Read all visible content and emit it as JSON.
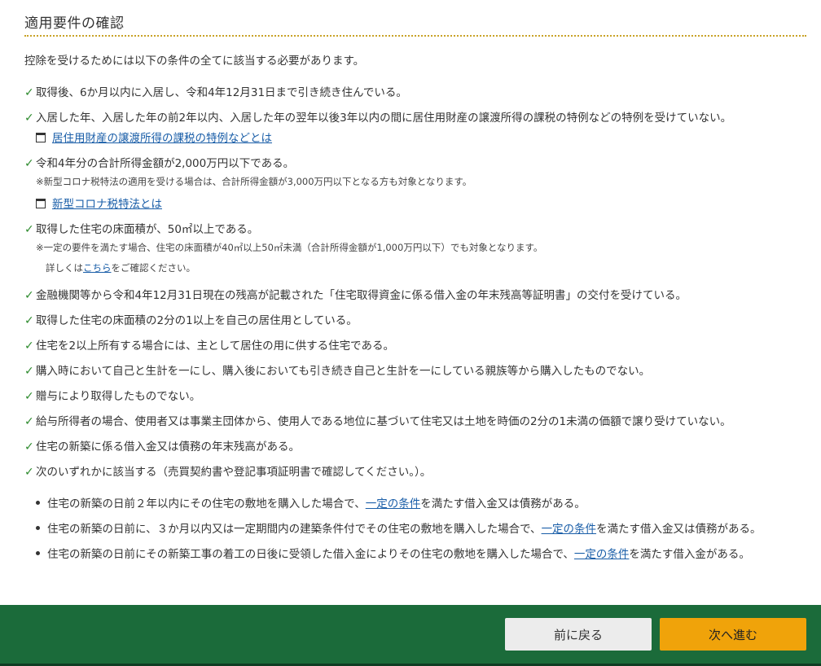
{
  "page": {
    "title": "適用要件の確認",
    "intro": "控除を受けるためには以下の条件の全てに該当する必要があります。"
  },
  "requirements": [
    {
      "text": "取得後、6か月以内に入居し、令和4年12月31日まで引き続き住んでいる。"
    },
    {
      "text": "入居した年、入居した年の前2年以内、入居した年の翌年以後3年以内の間に居住用財産の譲渡所得の課税の特例などの特例を受けていない。",
      "link": "居住用財産の譲渡所得の課税の特例などとは"
    },
    {
      "text": "令和4年分の合計所得金額が2,000万円以下である。",
      "note": "※新型コロナ税特法の適用を受ける場合は、合計所得金額が3,000万円以下となる方も対象となります。",
      "link": "新型コロナ税特法とは"
    },
    {
      "text": "取得した住宅の床面積が、50㎡以上である。",
      "note": "※一定の要件を満たす場合、住宅の床面積が40㎡以上50㎡未満（合計所得金額が1,000万円以下）でも対象となります。",
      "note2_prefix": "詳しくは",
      "note2_link": "こちら",
      "note2_suffix": "をご確認ください。"
    },
    {
      "text": "金融機関等から令和4年12月31日現在の残高が記載された「住宅取得資金に係る借入金の年末残高等証明書」の交付を受けている。"
    },
    {
      "text": "取得した住宅の床面積の2分の1以上を自己の居住用としている。"
    },
    {
      "text": "住宅を2以上所有する場合には、主として居住の用に供する住宅である。"
    },
    {
      "text": "購入時において自己と生計を一にし、購入後においても引き続き自己と生計を一にしている親族等から購入したものでない。"
    },
    {
      "text": "贈与により取得したものでない。"
    },
    {
      "text": "給与所得者の場合、使用者又は事業主団体から、使用人である地位に基づいて住宅又は土地を時価の2分の1未満の価額で譲り受けていない。"
    },
    {
      "text": "住宅の新築に係る借入金又は債務の年末残高がある。"
    },
    {
      "text": "次のいずれかに該当する（売買契約書や登記事項証明書で確認してください。）。"
    }
  ],
  "sub_items": [
    {
      "prefix": "住宅の新築の日前２年以内にその住宅の敷地を購入した場合で、",
      "link": "一定の条件",
      "suffix": "を満たす借入金又は債務がある。"
    },
    {
      "prefix": "住宅の新築の日前に、３か月以内又は一定期間内の建築条件付でその住宅の敷地を購入した場合で、",
      "link": "一定の条件",
      "suffix": "を満たす借入金又は債務がある。"
    },
    {
      "prefix": "住宅の新築の日前にその新築工事の着工の日後に受領した借入金によりその住宅の敷地を購入した場合で、",
      "link": "一定の条件",
      "suffix": "を満たす借入金がある。"
    }
  ],
  "icons": {
    "check": "check-icon",
    "doc": "window-icon"
  },
  "colors": {
    "accent_green": "#1b6b3a",
    "next_button": "#f0a30a",
    "link": "#1a5ea8",
    "check": "#2e8b2e",
    "rule": "#c9a227"
  },
  "footer": {
    "back_label": "前に戻る",
    "next_label": "次へ進む"
  }
}
